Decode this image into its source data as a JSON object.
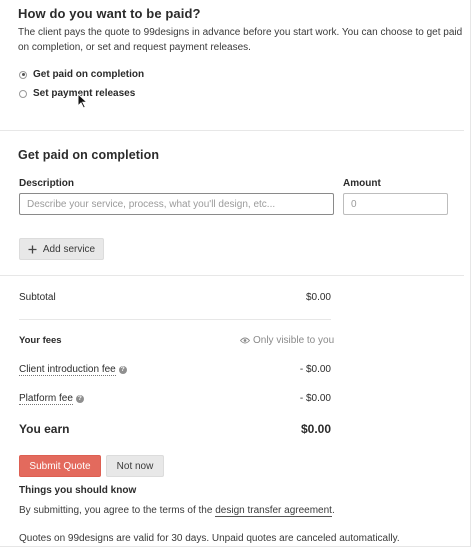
{
  "payment_question": {
    "title": "How do you want to be paid?",
    "description": "The client pays the quote to 99designs in advance before you start work. You can choose to get paid on completion, or set and request payment releases.",
    "options": [
      {
        "label": "Get paid on completion",
        "selected": true
      },
      {
        "label": "Set payment releases",
        "selected": false
      }
    ]
  },
  "completion": {
    "title": "Get paid on completion",
    "description_label": "Description",
    "description_placeholder": "Describe your service, process, what you'll design, etc...",
    "amount_label": "Amount",
    "amount_placeholder": "0",
    "add_service_label": "Add service"
  },
  "summary": {
    "subtotal_label": "Subtotal",
    "subtotal_value": "$0.00",
    "fees_label": "Your fees",
    "visibility_note": "Only visible to you",
    "client_fee_label": "Client introduction fee",
    "client_fee_value": "- $0.00",
    "platform_fee_label": "Platform fee",
    "platform_fee_value": "- $0.00",
    "earn_label": "You earn",
    "earn_value": "$0.00"
  },
  "actions": {
    "submit_label": "Submit Quote",
    "cancel_label": "Not now"
  },
  "info": {
    "title": "Things you should know",
    "terms_prefix": "By submitting, you agree to the terms of the ",
    "terms_link": "design transfer agreement",
    "terms_suffix": ".",
    "validity": "Quotes on 99designs are valid for 30 days. Unpaid quotes are canceled automatically."
  },
  "colors": {
    "primary_button": "#e36a5d",
    "secondary_button": "#e8e8e8"
  }
}
